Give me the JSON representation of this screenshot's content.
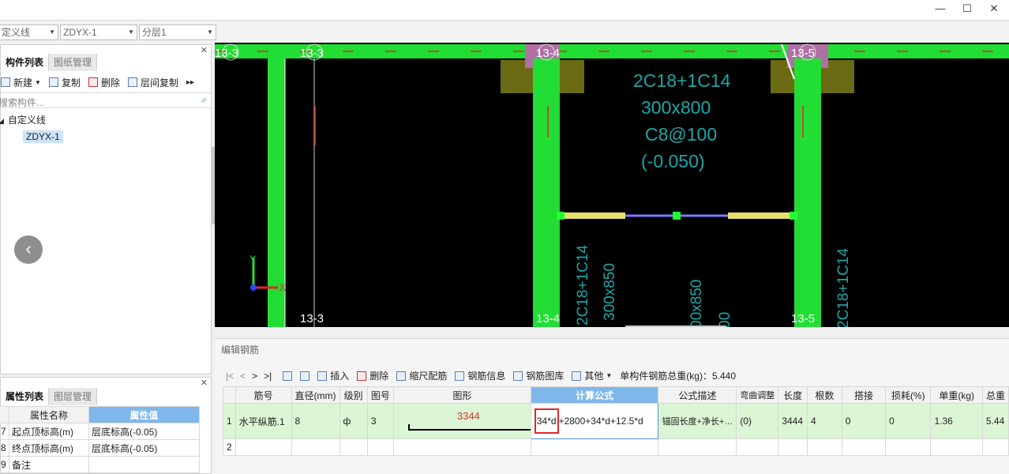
{
  "window": {
    "minimize": "—",
    "maximize": "☐",
    "close": "✕"
  },
  "selectors": [
    {
      "value": "定义线"
    },
    {
      "value": "ZDYX-1"
    },
    {
      "value": "分层1"
    }
  ],
  "component_panel": {
    "tabs": [
      "构件列表",
      "图纸管理"
    ],
    "toolbar": {
      "new": "新建",
      "copy": "复制",
      "delete": "删除",
      "floor_copy": "层间复制",
      "more": "▸▸"
    },
    "search_placeholder": "搜索构件...",
    "tree": {
      "root": "自定义线",
      "child": "ZDYX-1"
    }
  },
  "property_panel": {
    "tabs": [
      "属性列表",
      "图层管理"
    ],
    "headers": {
      "name": "属性名称",
      "value": "属性值"
    },
    "rows": [
      {
        "num": "7",
        "name": "起点顶标高(m)",
        "value": "层底标高(-0.05)"
      },
      {
        "num": "8",
        "name": "终点顶标高(m)",
        "value": "层底标高(-0.05)"
      },
      {
        "num": "9",
        "name": "备注",
        "value": ""
      }
    ]
  },
  "cad": {
    "axis_labels": [
      "13-3",
      "13-3",
      "13-4",
      "13-5",
      "13-3",
      "13-4",
      "13-5"
    ],
    "beam_text": [
      "2C18+1C14",
      "300x800",
      "C8@100",
      "(-0.050)"
    ],
    "vertical_text": [
      "2C18+1C14",
      "300x850",
      "00x850",
      "00",
      "2C18+1C14"
    ],
    "axes": {
      "x": "X",
      "y": "Y"
    }
  },
  "editor": {
    "title": "编辑钢筋",
    "nav": [
      "|<",
      "<",
      ">",
      ">|"
    ],
    "tools": {
      "insert": "插入",
      "delete": "删除",
      "scale": "缩尺配筋",
      "info": "钢筋信息",
      "library": "钢筋图库",
      "other": "其他",
      "total_label": "单构件钢筋总重(kg)：",
      "total_value": "5.440"
    },
    "columns": [
      "",
      "筋号",
      "直径(mm)",
      "级别",
      "图号",
      "图形",
      "计算公式",
      "公式描述",
      "弯曲调整",
      "长度",
      "根数",
      "搭接",
      "损耗(%)",
      "单重(kg)",
      "总重"
    ],
    "rows": [
      {
        "num": "1",
        "name": "水平纵筋.1",
        "dia": "8",
        "grade": "ф",
        "fig": "3",
        "shape_len": "3344",
        "formula_mark": "34*d",
        "formula_rest": "+2800+34*d+12.5*d",
        "desc": "锚固长度+净长+…",
        "bend": "(0)",
        "length": "3444",
        "count": "4",
        "lap": "0",
        "loss": "0",
        "unit_wt": "1.36",
        "total_wt": "5.44"
      },
      {
        "num": "2",
        "name": "",
        "dia": "",
        "grade": "",
        "fig": "",
        "shape_len": "",
        "formula_mark": "",
        "formula_rest": "",
        "desc": "",
        "bend": "",
        "length": "",
        "count": "",
        "lap": "",
        "loss": "",
        "unit_wt": "",
        "total_wt": ""
      }
    ]
  },
  "colors": {
    "beam": "#22dd33",
    "bg": "#000000",
    "highlight": "#e0282a",
    "header_sel": "#7fb7ec"
  }
}
